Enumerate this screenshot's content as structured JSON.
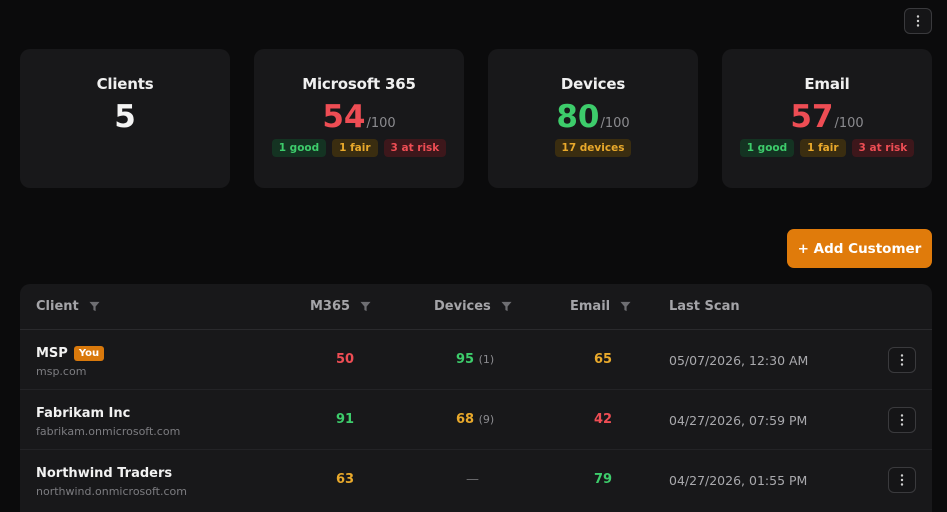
{
  "cards": [
    {
      "title": "Clients",
      "value": "5",
      "suffix": "",
      "color": "#f4f4f4",
      "badges": []
    },
    {
      "title": "Microsoft 365",
      "value": "54",
      "suffix": "/100",
      "color": "#ee4d54",
      "badges": [
        {
          "label": "1 good",
          "kind": "good"
        },
        {
          "label": "1 fair",
          "kind": "fair"
        },
        {
          "label": "3 at risk",
          "kind": "risk"
        }
      ]
    },
    {
      "title": "Devices",
      "value": "80",
      "suffix": "/100",
      "color": "#3dcc6b",
      "badges": [
        {
          "label": "17 devices",
          "kind": "dev"
        }
      ]
    },
    {
      "title": "Email",
      "value": "57",
      "suffix": "/100",
      "color": "#ee4d54",
      "badges": [
        {
          "label": "1 good",
          "kind": "good"
        },
        {
          "label": "1 fair",
          "kind": "fair"
        },
        {
          "label": "3 at risk",
          "kind": "risk"
        }
      ]
    }
  ],
  "add_button": "+ Add Customer",
  "columns": [
    "Client",
    "M365",
    "Devices",
    "Email",
    "Last Scan"
  ],
  "rows": [
    {
      "name": "MSP",
      "tag": "You",
      "domain": "msp.com",
      "m365": "50",
      "m365_color": "red",
      "devices": "95",
      "devices_count": "(1)",
      "devices_color": "green",
      "email": "65",
      "email_color": "orange",
      "last_scan": "05/07/2026, 12:30 AM"
    },
    {
      "name": "Fabrikam Inc",
      "tag": "",
      "domain": "fabrikam.onmicrosoft.com",
      "m365": "91",
      "m365_color": "green",
      "devices": "68",
      "devices_count": "(9)",
      "devices_color": "orange",
      "email": "42",
      "email_color": "red",
      "last_scan": "04/27/2026, 07:59 PM"
    },
    {
      "name": "Northwind Traders",
      "tag": "",
      "domain": "northwind.onmicrosoft.com",
      "m365": "63",
      "m365_color": "orange",
      "devices": "—",
      "devices_count": "",
      "devices_color": "dash",
      "email": "79",
      "email_color": "green",
      "last_scan": "04/27/2026, 01:55 PM"
    }
  ]
}
